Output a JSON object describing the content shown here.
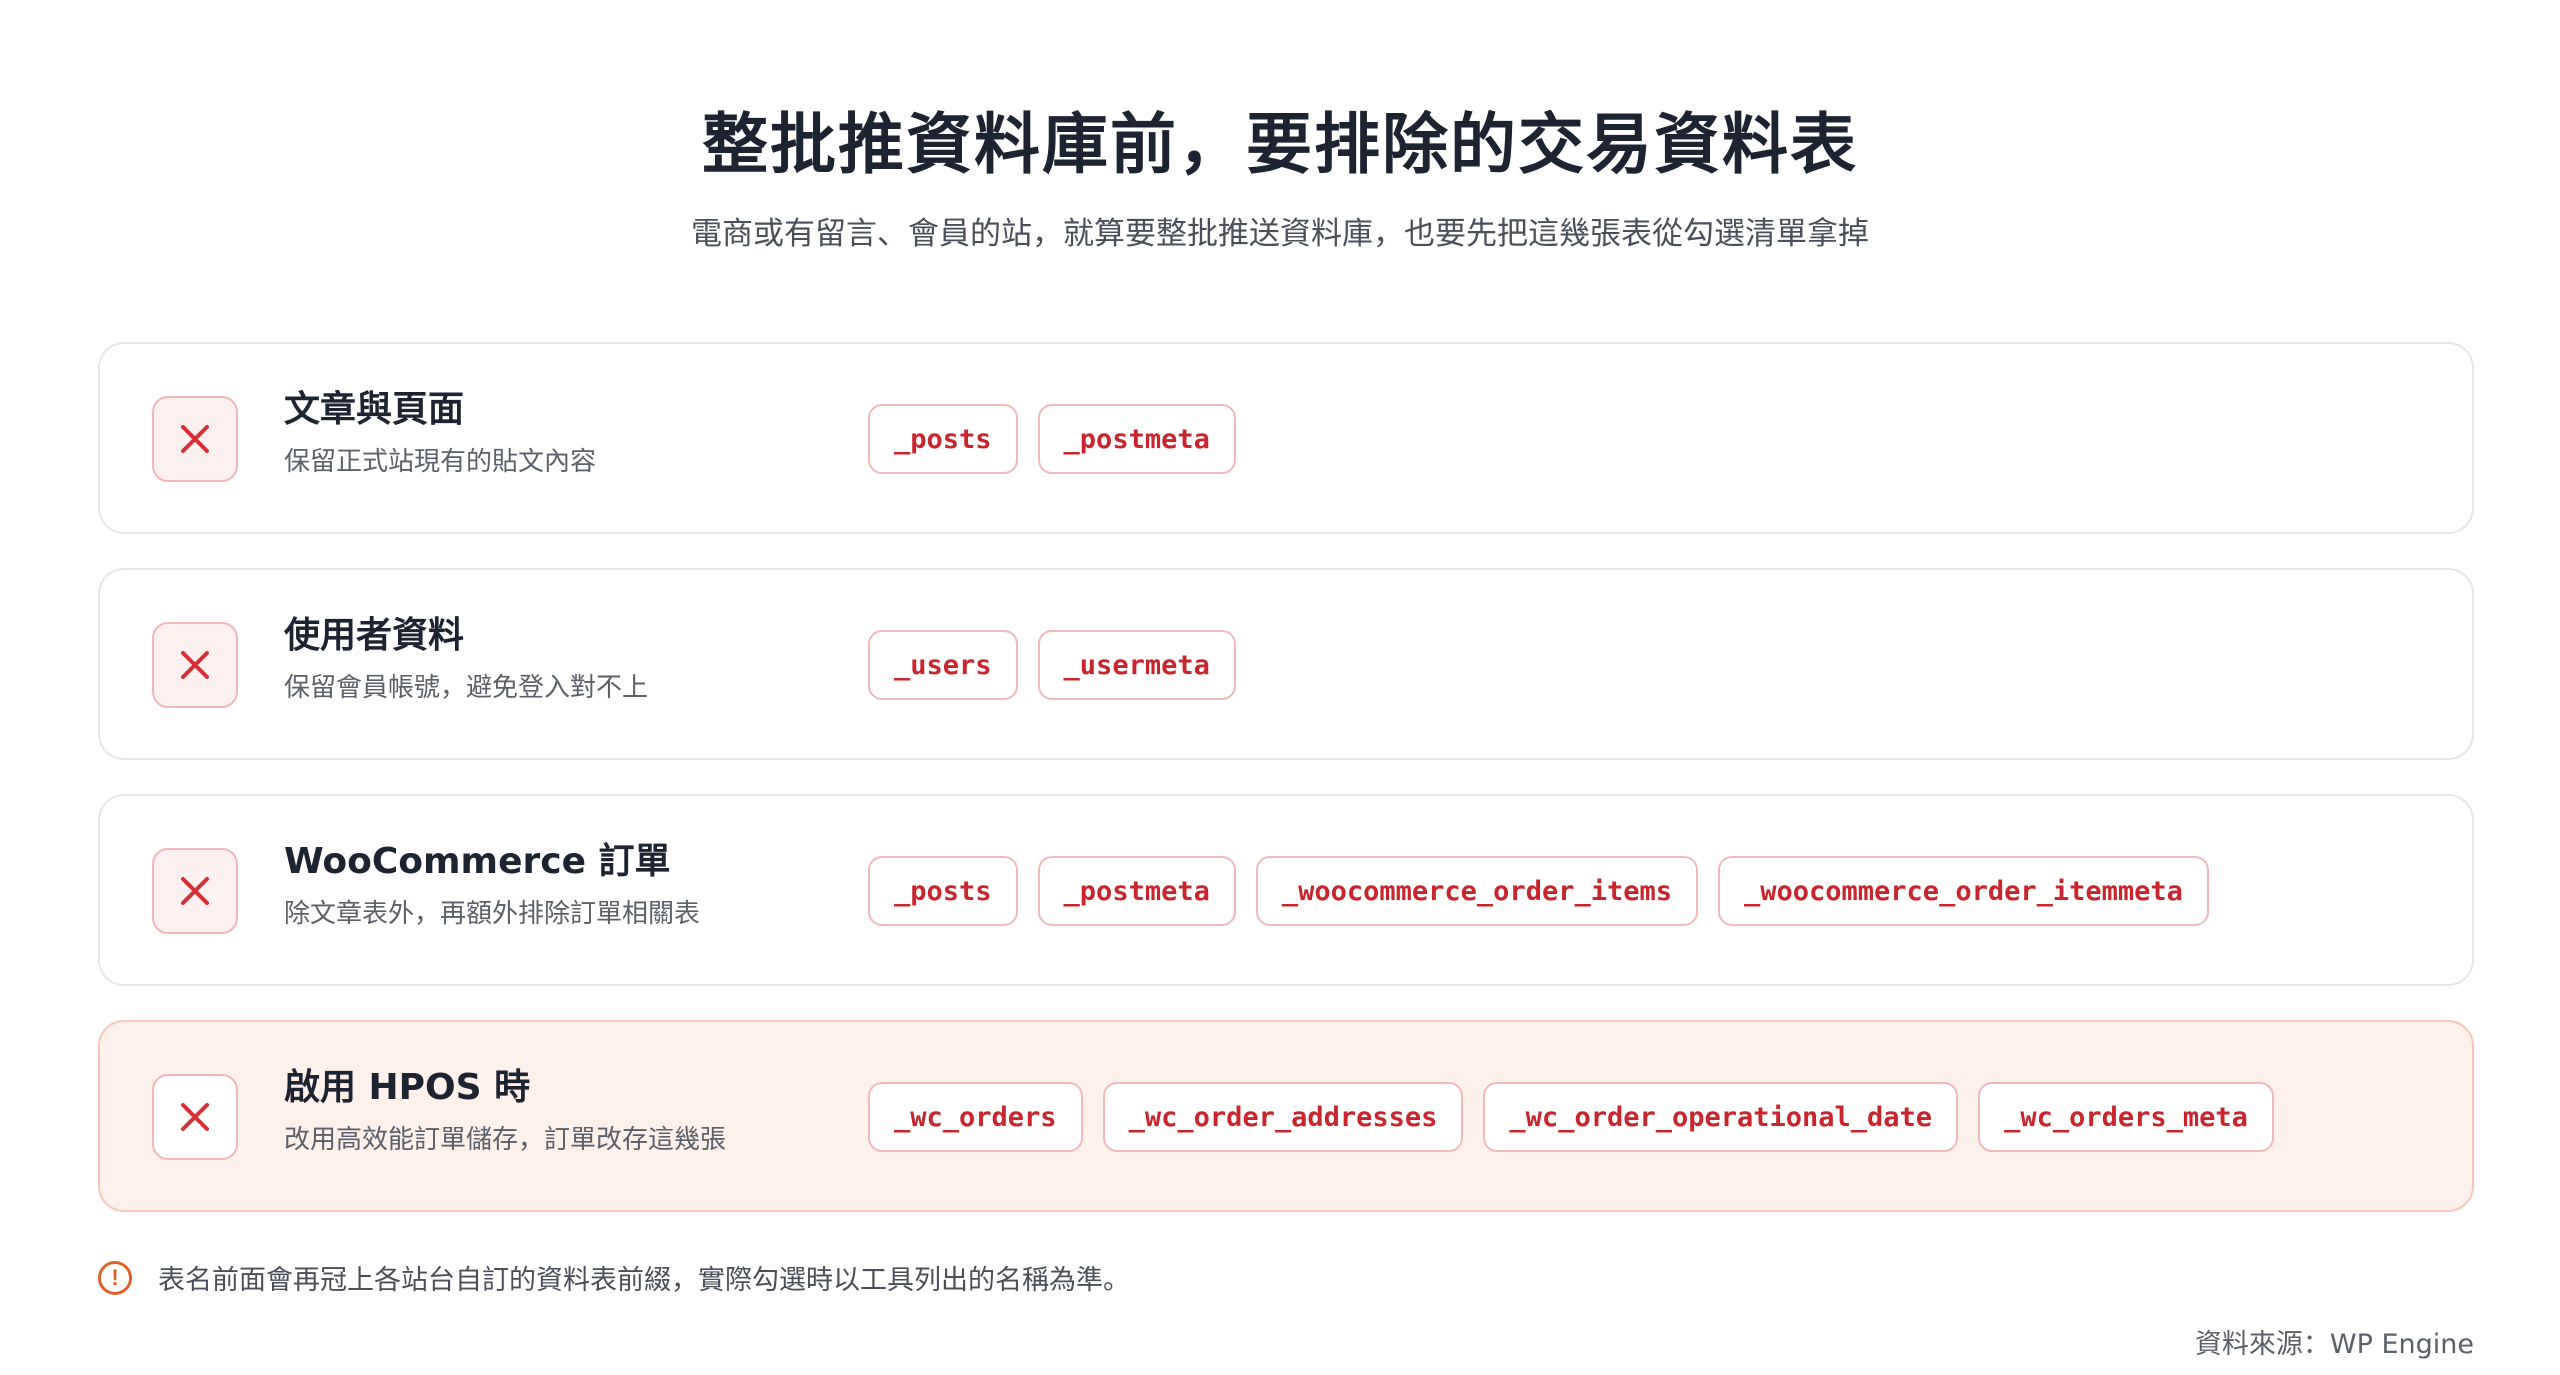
{
  "title": "整批推資料庫前，要排除的交易資料表",
  "subtitle": "電商或有留言、會員的站，就算要整批推送資料庫，也要先把這幾張表從勾選清單拿掉",
  "cards": [
    {
      "icon": "close-icon",
      "title": "文章與頁面",
      "description": "保留正式站現有的貼文內容",
      "tables": [
        "_posts",
        "_postmeta"
      ]
    },
    {
      "icon": "close-icon",
      "title": "使用者資料",
      "description": "保留會員帳號，避免登入對不上",
      "tables": [
        "_users",
        "_usermeta"
      ]
    },
    {
      "icon": "close-icon",
      "title": "WooCommerce 訂單",
      "description": "除文章表外，再額外排除訂單相關表",
      "tables": [
        "_posts",
        "_postmeta",
        "_woocommerce_order_items",
        "_woocommerce_order_itemmeta"
      ]
    },
    {
      "icon": "close-icon",
      "title": "啟用 HPOS 時",
      "description": "改用高效能訂單儲存，訂單改存這幾張",
      "tables": [
        "_wc_orders",
        "_wc_order_addresses",
        "_wc_order_operational_date",
        "_wc_orders_meta"
      ],
      "highlighted": true
    }
  ],
  "note": {
    "icon": "alert-circle-icon",
    "icon_glyph": "!",
    "text": "表名前面會再冠上各站台自訂的資料表前綴，實際勾選時以工具列出的名稱為準。"
  },
  "source": "資料來源：WP Engine",
  "colors": {
    "accent_red": "#c8262c",
    "warning_orange": "#e0622b",
    "highlight_bg": "#fef0ea"
  }
}
